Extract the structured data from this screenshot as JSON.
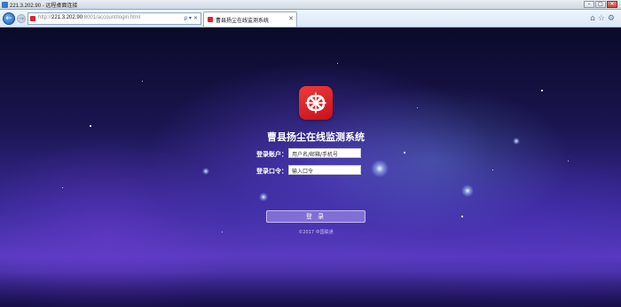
{
  "remote_desktop": {
    "title": "221.3.202.90 - 远程桌面连接",
    "controls": {
      "minimize": "–",
      "maximize": "□",
      "close": "✕"
    }
  },
  "browser": {
    "back_glyph": "←",
    "forward_glyph": "→",
    "url_scheme": "http://",
    "url_host": "221.3.202.90",
    "url_path": ":8001/account/login.html",
    "address_icons": "ρ ▾ ✕",
    "tab_title": "曹县扬尘在线监测系统",
    "tab_close": "✕",
    "right_icons": "⌂☆⚙"
  },
  "login": {
    "logo_icon": "china-unicom-knot-icon",
    "system_title": "曹县扬尘在线监测系统",
    "account_label": "登录账户：",
    "account_placeholder": "用户名/邮箱/手机号",
    "password_label": "登录口令：",
    "password_placeholder": "输入口令",
    "submit_label": "登 录",
    "copyright": "©2017 中国联通"
  },
  "colors": {
    "logo_red": "#d9262c",
    "background_purple": "#3a2a9a"
  }
}
